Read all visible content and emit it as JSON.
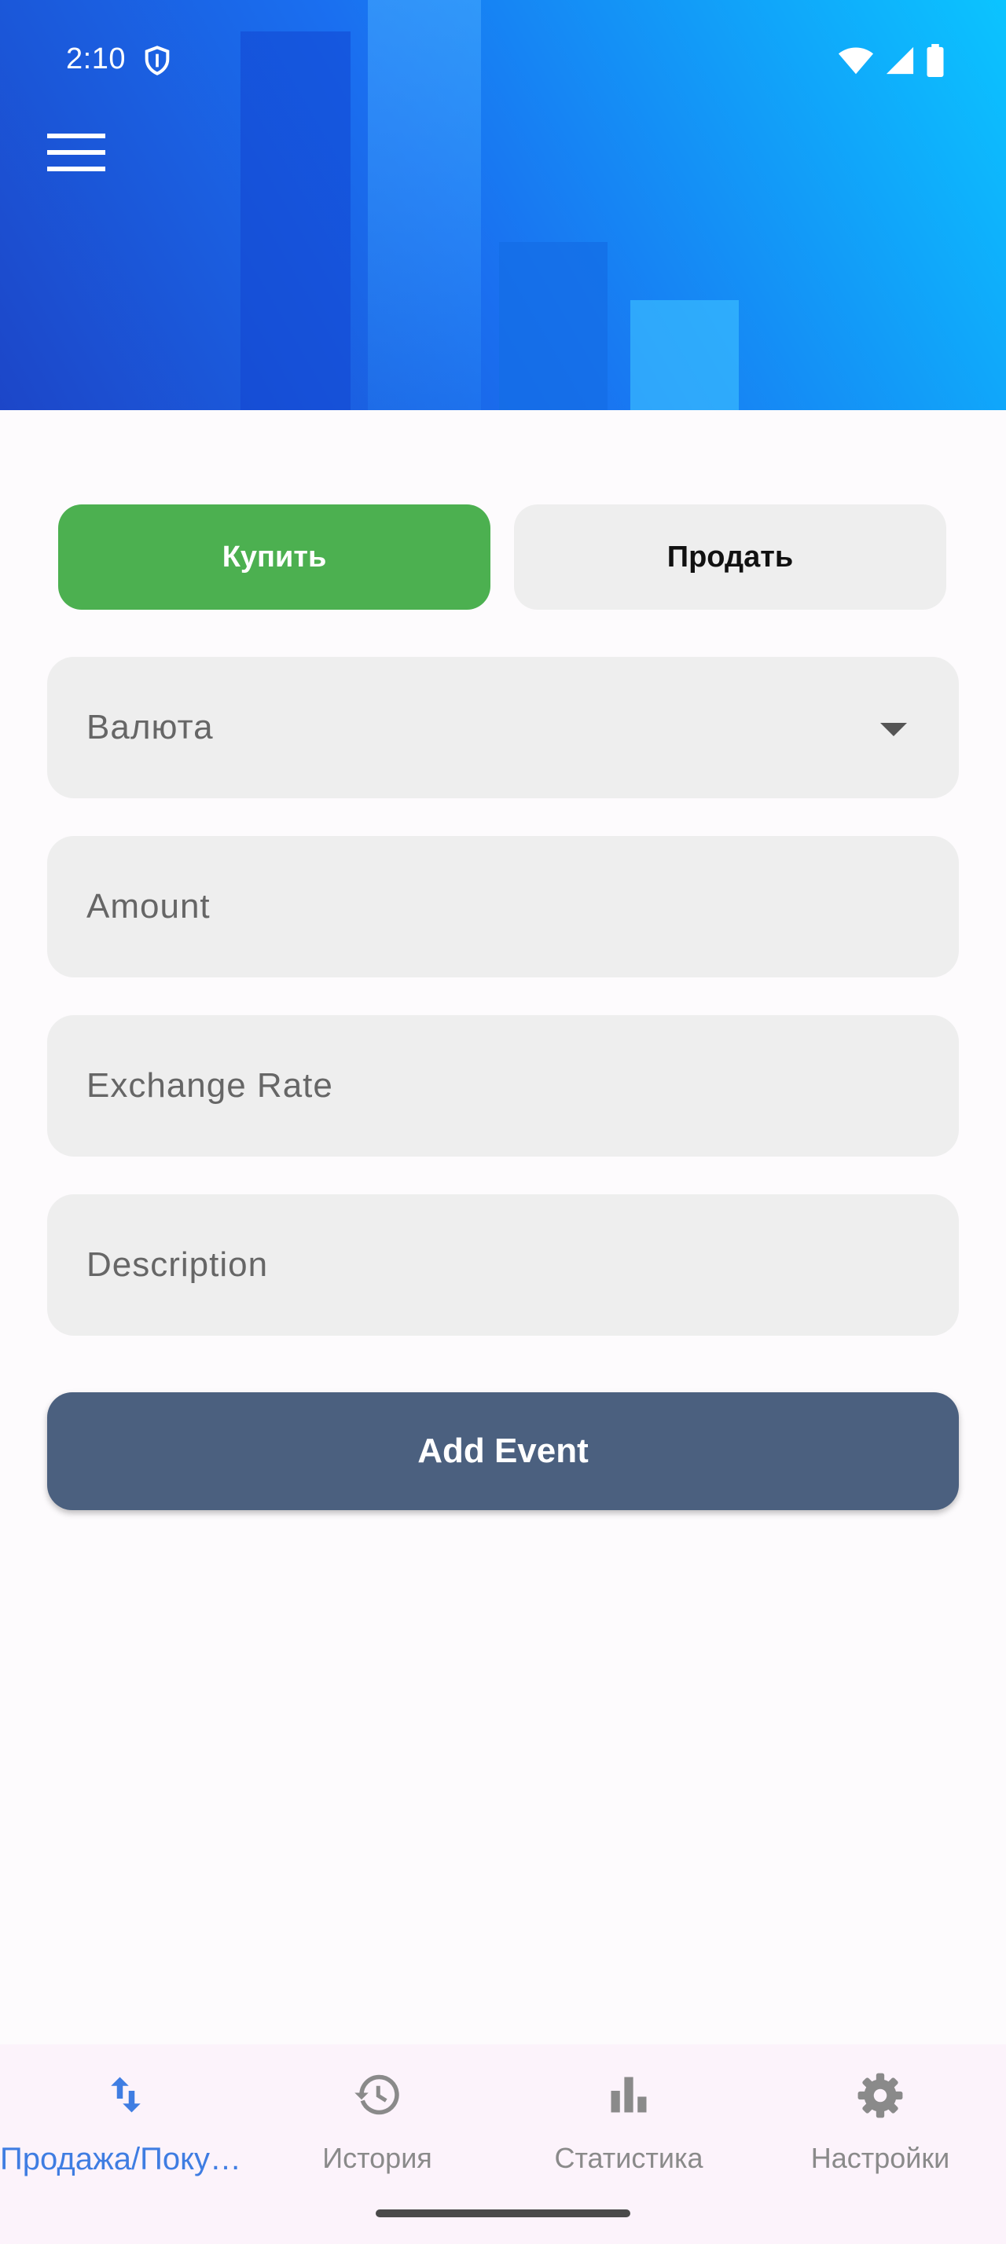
{
  "status_bar": {
    "time": "2:10",
    "left_icon": "shield-icon",
    "right_icons": [
      "wifi-icon",
      "cell-signal-icon",
      "battery-icon"
    ]
  },
  "header": {
    "menu_icon": "menu-icon",
    "gradient_colors": [
      "#1c46c8",
      "#1a6ff0",
      "#0bc4ff"
    ]
  },
  "form": {
    "buy_label": "Купить",
    "sell_label": "Продать",
    "currency_placeholder": "Валюта",
    "amount_placeholder": "Amount",
    "rate_placeholder": "Exchange Rate",
    "description_placeholder": "Description",
    "submit_label": "Add Event",
    "colors": {
      "buy": "#4cb050",
      "submit": "#4b607f",
      "field": "#eeeeee"
    }
  },
  "nav": {
    "items": [
      {
        "label": "Продажа/Покупка",
        "icon": "swap-vertical-icon",
        "active": true
      },
      {
        "label": "История",
        "icon": "history-icon",
        "active": false
      },
      {
        "label": "Статистика",
        "icon": "bar-chart-icon",
        "active": false
      },
      {
        "label": "Настройки",
        "icon": "settings-icon",
        "active": false
      }
    ],
    "active_color": "#3f7de2"
  }
}
